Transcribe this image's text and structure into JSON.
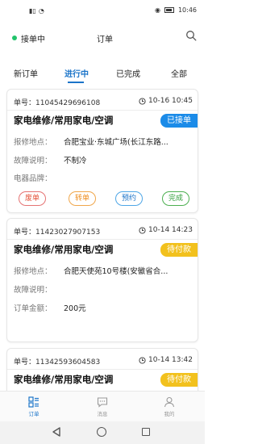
{
  "status_bar": {
    "signal_text": "ᵒᵍ",
    "time": "10:46"
  },
  "header": {
    "online_status": "接单中",
    "title": "订单"
  },
  "tabs": [
    {
      "label": "新订单",
      "active": false
    },
    {
      "label": "进行中",
      "active": true
    },
    {
      "label": "已完成",
      "active": false
    },
    {
      "label": "全部",
      "active": false
    }
  ],
  "orders": [
    {
      "order_label": "单号：",
      "order_no": "11045429696108",
      "time": "10-16 10:45",
      "title": "家电维修/常用家电/空调",
      "badge": "已接单",
      "badge_color": "#1b8be8",
      "fields": [
        {
          "label": "报修地点：",
          "value": "合肥宝业·东城广场(长江东路..."
        },
        {
          "label": "故障说明：",
          "value": "不制冷"
        },
        {
          "label": "电器品牌：",
          "value": ""
        }
      ],
      "actions": [
        "废单",
        "转单",
        "预约",
        "完成"
      ]
    },
    {
      "order_label": "单号：",
      "order_no": "11423027907153",
      "time": "10-14 14:23",
      "title": "家电维修/常用家电/空调",
      "badge": "待付款",
      "badge_color": "#f2c11d",
      "fields": [
        {
          "label": "报修地点：",
          "value": "合肥天使苑10号楼(安徽省合..."
        },
        {
          "label": "故障说明：",
          "value": ""
        },
        {
          "label": "订单金额：",
          "value": "200元"
        }
      ]
    },
    {
      "order_label": "单号：",
      "order_no": "11342593604583",
      "time": "10-14 13:42",
      "title": "家电维修/常用家电/空调",
      "badge": "待付款",
      "badge_color": "#f2c11d"
    }
  ],
  "bottom_nav": [
    {
      "label": "订单",
      "icon": "order-list-icon",
      "active": true
    },
    {
      "label": "消息",
      "icon": "message-icon",
      "active": false
    },
    {
      "label": "我的",
      "icon": "user-icon",
      "active": false
    }
  ],
  "accent_color": "#1b74c9"
}
